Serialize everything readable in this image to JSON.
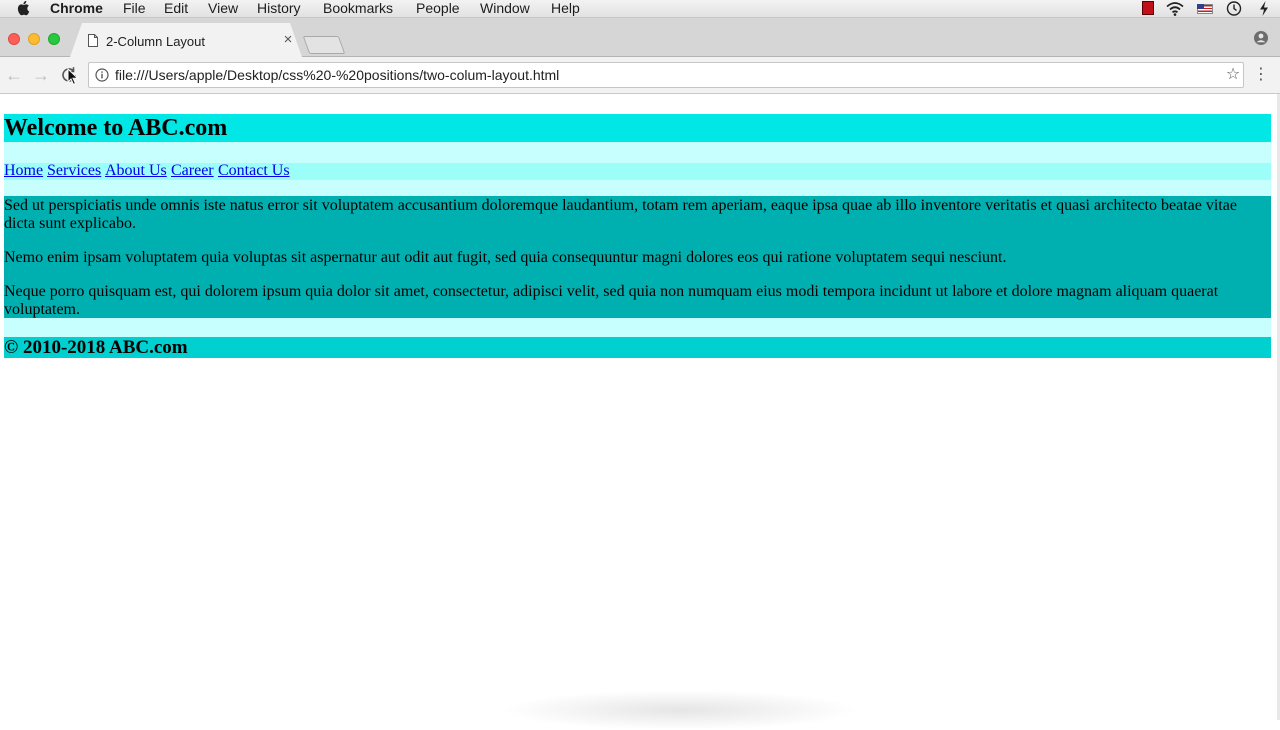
{
  "menubar": {
    "apple_icon": "apple-icon",
    "items": [
      {
        "label": "Chrome",
        "bold": true
      },
      {
        "label": "File"
      },
      {
        "label": "Edit"
      },
      {
        "label": "View"
      },
      {
        "label": "History"
      },
      {
        "label": "Bookmarks"
      },
      {
        "label": "People"
      },
      {
        "label": "Window"
      },
      {
        "label": "Help"
      }
    ],
    "tray_icons": [
      "red-app-icon",
      "wifi-icon",
      "us-flag-icon",
      "time-machine-icon",
      "bolt-icon"
    ]
  },
  "browser": {
    "tab": {
      "title": "2-Column Layout",
      "close": "×",
      "icon": "page-icon"
    },
    "toolbar": {
      "back": "←",
      "forward": "→",
      "url": "file:///Users/apple/Desktop/css%20-%20positions/two-colum-layout.html",
      "star": "☆",
      "menu": "⋮"
    }
  },
  "page": {
    "header_title": "Welcome to ABC.com",
    "nav_links": [
      "Home",
      "Services",
      "About Us",
      "Career",
      "Contact Us"
    ],
    "paragraphs": [
      "Sed ut perspiciatis unde omnis iste natus error sit voluptatem accusantium doloremque laudantium, totam rem aperiam, eaque ipsa quae ab illo inventore veritatis et quasi architecto beatae vitae dicta sunt explicabo.",
      "Nemo enim ipsam voluptatem quia voluptas sit aspernatur aut odit aut fugit, sed quia consequuntur magni dolores eos qui ratione voluptatem sequi nesciunt.",
      "Neque porro quisquam est, qui dolorem ipsum quia dolor sit amet, consectetur, adipisci velit, sed quia non numquam eius modi tempora incidunt ut labore et dolore magnam aliquam quaerat voluptatem."
    ],
    "footer": "© 2010-2018 ABC.com"
  },
  "colors": {
    "header": "#00e7e6",
    "nav": "#9cfef8",
    "gap": "#c7ffff",
    "content": "#00afaf",
    "footer": "#00d0d0",
    "link": "#0000ee"
  }
}
